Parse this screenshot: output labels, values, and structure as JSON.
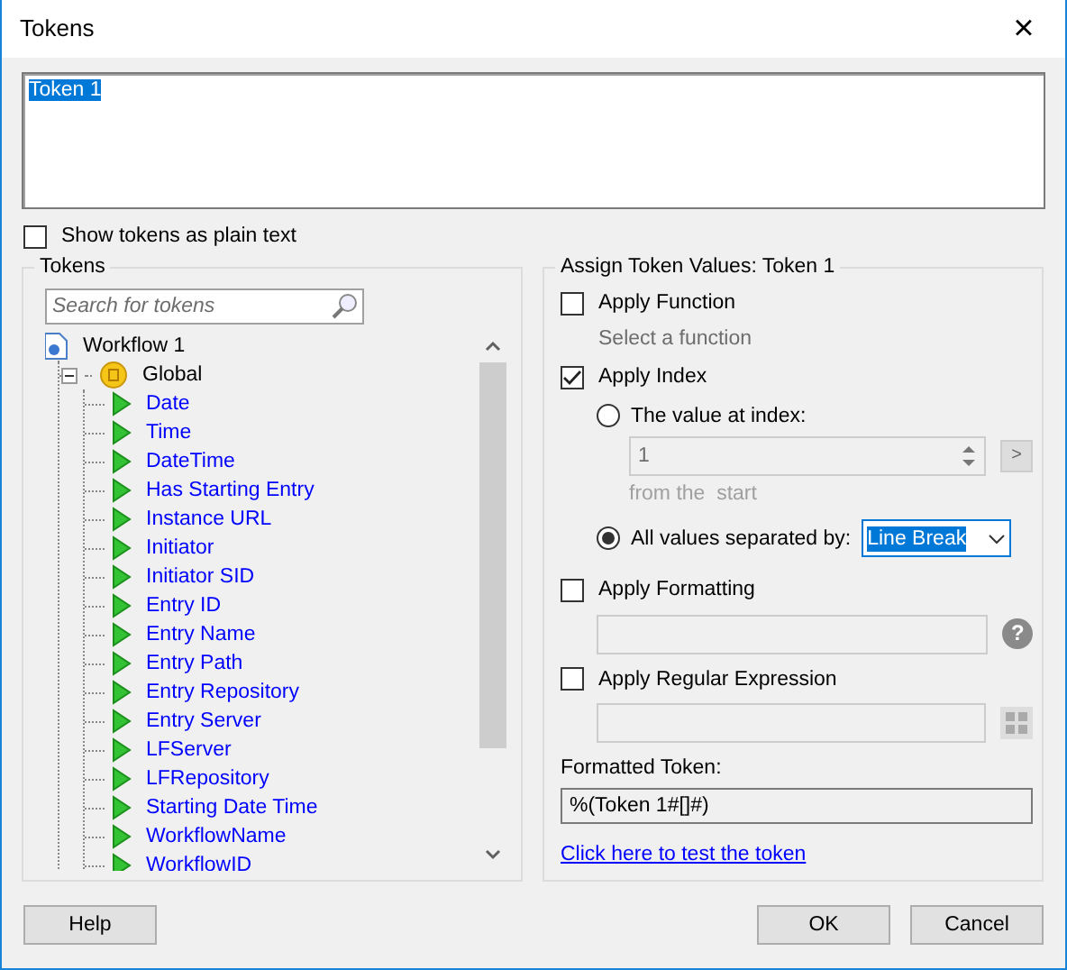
{
  "window": {
    "title": "Tokens",
    "close": "×"
  },
  "token_text": {
    "value": "Token 1",
    "highlighted": true
  },
  "plain_text": {
    "label": "Show tokens as plain text",
    "checked": false
  },
  "tokens_panel": {
    "title": "Tokens",
    "search": {
      "placeholder": "Search for tokens"
    },
    "tree": [
      {
        "label": "Workflow 1",
        "kind": "workflow",
        "children": [
          {
            "label": "Global",
            "kind": "group",
            "expanded": true,
            "children": [
              {
                "label": "Date",
                "kind": "token"
              },
              {
                "label": "Time",
                "kind": "token"
              },
              {
                "label": "DateTime",
                "kind": "token"
              },
              {
                "label": "Has Starting Entry",
                "kind": "token"
              },
              {
                "label": "Instance URL",
                "kind": "token"
              },
              {
                "label": "Initiator",
                "kind": "token"
              },
              {
                "label": "Initiator SID",
                "kind": "token"
              },
              {
                "label": "Entry ID",
                "kind": "token"
              },
              {
                "label": "Entry Name",
                "kind": "token"
              },
              {
                "label": "Entry Path",
                "kind": "token"
              },
              {
                "label": "Entry Repository",
                "kind": "token"
              },
              {
                "label": "Entry Server",
                "kind": "token"
              },
              {
                "label": "LFServer",
                "kind": "token"
              },
              {
                "label": "LFRepository",
                "kind": "token"
              },
              {
                "label": "Starting Date Time",
                "kind": "token"
              },
              {
                "label": "WorkflowName",
                "kind": "token"
              },
              {
                "label": "WorkflowID",
                "kind": "token"
              }
            ]
          }
        ]
      }
    ]
  },
  "assign_panel": {
    "title": "Assign Token Values: Token 1",
    "function": {
      "label": "Apply Function",
      "checked": false,
      "hint": "Select a function"
    },
    "index": {
      "label": "Apply Index",
      "checked": true,
      "options": [
        {
          "label": "The value at index:",
          "selected": false,
          "kind": "spin",
          "value": "1",
          "note": "from the  start",
          "button": ">"
        },
        {
          "label": "All values separated by:",
          "selected": true,
          "kind": "select",
          "value": "Line Break",
          "highlighted": true
        }
      ]
    },
    "formatting": {
      "label": "Apply Formatting",
      "checked": false,
      "help": "?"
    },
    "regex": {
      "label": "Apply Regular Expression",
      "checked": false
    },
    "formatted_token": {
      "label": "Formatted Token:",
      "value": "%(Token 1#[]#)"
    },
    "test_link": "Click here to test the token"
  },
  "buttons": {
    "help": "Help",
    "ok": "OK",
    "cancel": "Cancel"
  }
}
